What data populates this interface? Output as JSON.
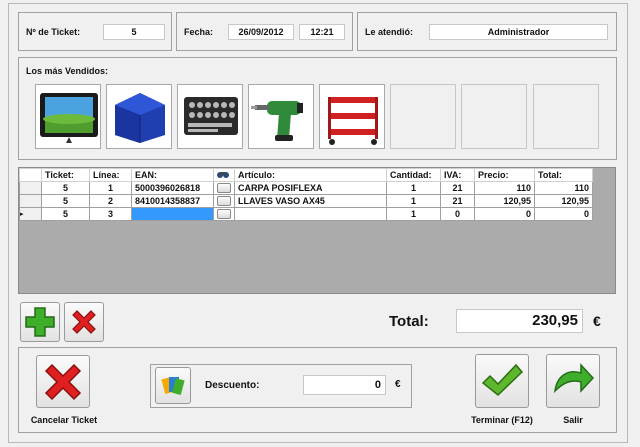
{
  "header": {
    "ticket_label": "Nº de Ticket:",
    "ticket_value": "5",
    "fecha_label": "Fecha:",
    "fecha_value": "26/09/2012",
    "hora_value": "12:21",
    "atendio_label": "Le atendió:",
    "atendio_value": "Administrador"
  },
  "vendidos": {
    "label": "Los más Vendidos:",
    "items": [
      "photo-frame",
      "blue-tent",
      "socket-wrench-set",
      "power-drill",
      "red-tool-cart",
      "",
      "",
      ""
    ]
  },
  "grid": {
    "columns": [
      "Ticket:",
      "Línea:",
      "EAN:",
      "",
      "Artículo:",
      "Cantidad:",
      "IVA:",
      "Precio:",
      "Total:"
    ],
    "rows": [
      [
        "5",
        "1",
        "5000396026818",
        "",
        "CARPA POSIFLEXA",
        "1",
        "21",
        "110",
        "110"
      ],
      [
        "5",
        "2",
        "8410014358837",
        "",
        "LLAVES VASO AX45",
        "1",
        "21",
        "120,95",
        "120,95"
      ],
      [
        "5",
        "3",
        "",
        "",
        "",
        "1",
        "0",
        "0",
        "0"
      ]
    ],
    "current_row_marker": "▸"
  },
  "totals": {
    "label": "Total:",
    "value": "230,95",
    "currency": "€"
  },
  "footer": {
    "cancel_label": "Cancelar Ticket",
    "descuento_label": "Descuento:",
    "descuento_value": "0",
    "descuento_currency": "€",
    "terminar_label": "Terminar (F12)",
    "salir_label": "Salir"
  },
  "colors": {
    "selection": "#3399ff",
    "add_green": "#3fae2a",
    "delete_red": "#e02020"
  }
}
